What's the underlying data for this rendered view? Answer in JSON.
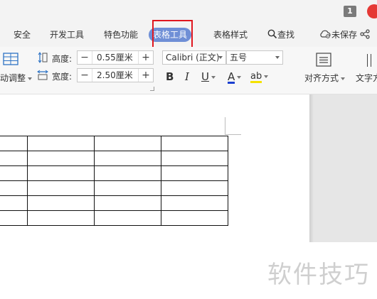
{
  "titlebar": {
    "badge": "1"
  },
  "tabs": [
    "安全",
    "开发工具",
    "特色功能",
    "表格工具",
    "表格样式"
  ],
  "tabs_right": {
    "search": "查找",
    "unsaved": "未保存"
  },
  "ribbon": {
    "autofit_label": "动调整",
    "height_label": "高度:",
    "height_value": "0.55厘米",
    "width_label": "宽度:",
    "width_value": "2.50厘米",
    "font_name": "Calibri (正文)",
    "font_size": "五号",
    "bold": "B",
    "italic": "I",
    "underline": "U",
    "font_color": "A",
    "highlight": "ab",
    "align_label": "对齐方式",
    "text_dir_label": "文字方",
    "minus": "−",
    "plus": "+"
  },
  "colors": {
    "active_tab": "#6f8fd6",
    "highlight_box": "#e0171f",
    "font_color_underline": "#1a3fd0",
    "highlight_color": "#f5e200"
  },
  "table": {
    "rows": 6,
    "cols": 4
  },
  "watermark": "软件技巧"
}
